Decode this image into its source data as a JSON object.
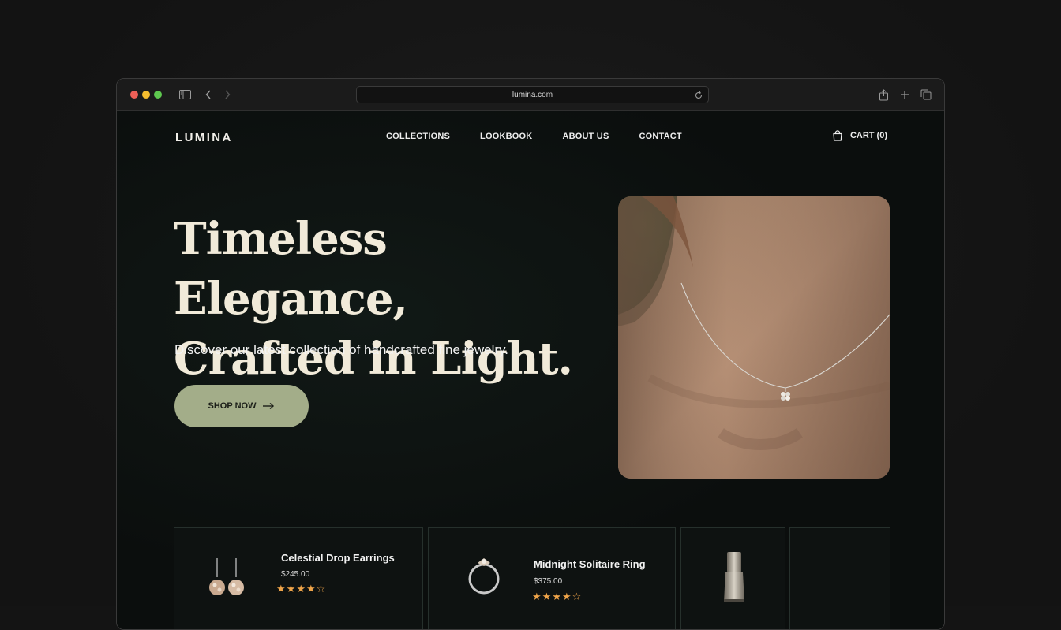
{
  "browser": {
    "url": "lumina.com",
    "icons": [
      "sidebar-icon",
      "back-icon",
      "forward-icon",
      "reload-icon",
      "share-icon",
      "new-tab-icon",
      "tabs-overview-icon"
    ]
  },
  "header": {
    "logo": "LUMINA",
    "nav": [
      "COLLECTIONS",
      "LOOKBOOK",
      "ABOUT US",
      "CONTACT"
    ],
    "cart_label": "CART (0)"
  },
  "hero": {
    "title_line1": "Timeless Elegance,",
    "title_line2": "Crafted in Light.",
    "subtitle": "Discover our latest collection of handcrafted fine jewelry.",
    "cta_label": "SHOP NOW",
    "image_alt": "necklace-on-model"
  },
  "products": [
    {
      "name": "Celestial Drop Earrings",
      "price": "$245.00",
      "rating": 4,
      "max_rating": 5
    },
    {
      "name": "Midnight Solitaire Ring",
      "price": "$375.00",
      "rating": 4,
      "max_rating": 5
    }
  ],
  "colors": {
    "accent": "#a3ad89",
    "star": "#f0a54a",
    "title": "#f1ead9"
  }
}
